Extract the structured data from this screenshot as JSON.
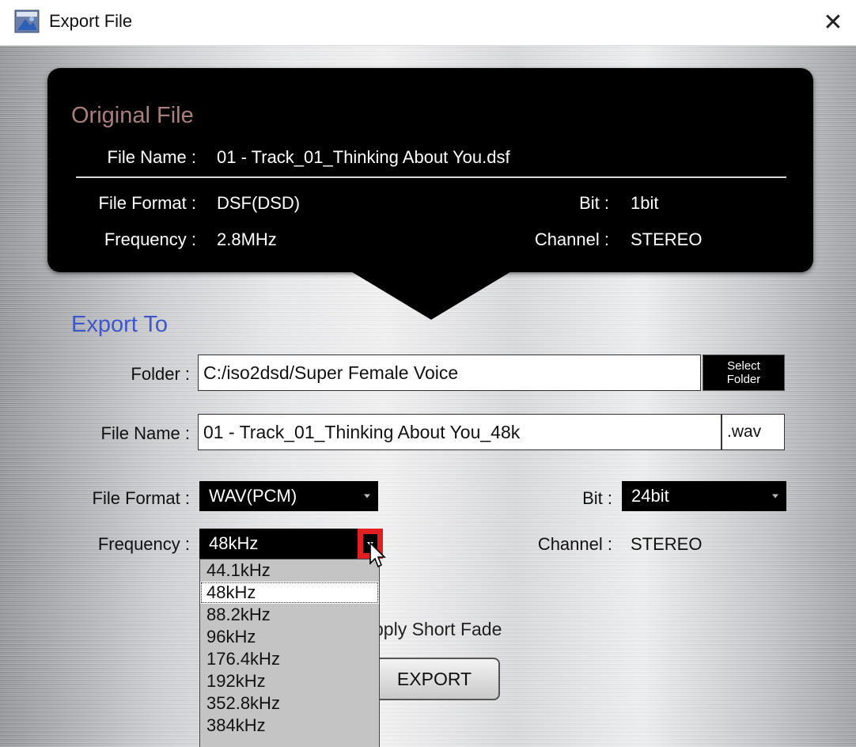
{
  "window": {
    "title": "Export File",
    "icon": "app-icon",
    "close_glyph": "✕"
  },
  "original": {
    "heading": "Original File",
    "file_name_label": "File Name :",
    "file_name": "01 - Track_01_Thinking About You.dsf",
    "file_format_label": "File Format :",
    "file_format": "DSF(DSD)",
    "frequency_label": "Frequency :",
    "frequency": "2.8MHz",
    "bit_label": "Bit :",
    "bit": "1bit",
    "channel_label": "Channel :",
    "channel": "STEREO"
  },
  "export": {
    "heading": "Export To",
    "folder_label": "Folder :",
    "folder_value": "C:/iso2dsd/Super Female Voice",
    "select_folder_line1": "Select",
    "select_folder_line2": "Folder",
    "file_name_label": "File Name :",
    "file_name_value": "01 - Track_01_Thinking About You_48k",
    "extension": ".wav",
    "file_format_label": "File Format :",
    "file_format_value": "WAV(PCM)",
    "bit_label": "Bit :",
    "bit_value": "24bit",
    "frequency_label": "Frequency :",
    "frequency_value": "48kHz",
    "channel_label": "Channel :",
    "channel_value": "STEREO",
    "frequency_options": [
      "44.1kHz",
      "48kHz",
      "88.2kHz",
      "96kHz",
      "176.4kHz",
      "192kHz",
      "352.8kHz",
      "384kHz"
    ],
    "frequency_selected_index": 1,
    "fade_label": "pply Short Fade",
    "export_button": "EXPORT"
  },
  "colors": {
    "original_heading": "#a87f7b",
    "export_heading": "#3f57c8",
    "highlight": "#e02020"
  }
}
